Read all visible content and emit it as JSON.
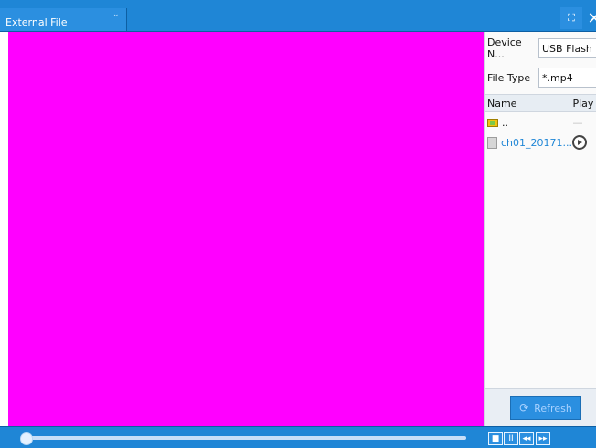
{
  "header": {
    "title": "External File"
  },
  "panel": {
    "device_name_label": "Device N...",
    "device_name_value": "USB Flash",
    "file_type_label": "File Type",
    "file_type_value": "*.mp4",
    "columns": [
      "Name",
      "Play"
    ],
    "rows": [
      {
        "name": "..",
        "play": "—"
      },
      {
        "name": "ch01_20171...",
        "play": ""
      }
    ],
    "refresh_label": "Refresh"
  },
  "playback": {
    "controls": [
      "■",
      "II",
      "◂◂",
      "▸▸"
    ]
  },
  "colors": {
    "bar_blue": "#1f86d6",
    "video_placeholder": "#ff00ff"
  },
  "icons": {
    "fullscreen": "fullscreen-icon",
    "close": "close-icon",
    "dropdown": "chevron-down-icon",
    "folder": "folder-icon",
    "file": "file-icon",
    "play": "play-icon",
    "refresh": "refresh-icon"
  }
}
